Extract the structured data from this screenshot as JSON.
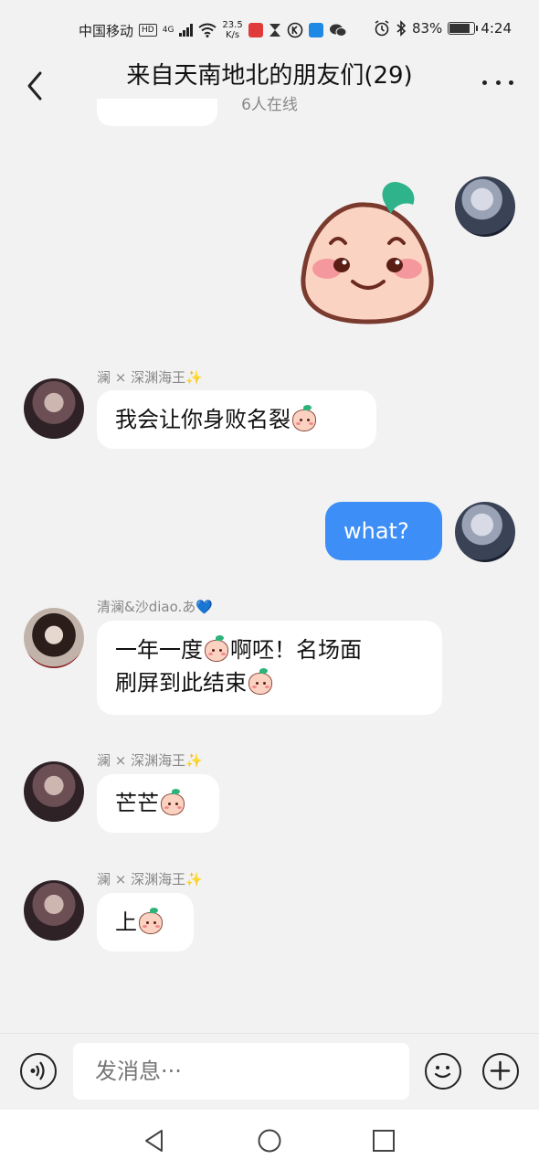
{
  "status_bar": {
    "carrier": "中国移动",
    "hd_badge": "HD",
    "network_type": "4G",
    "speed_value": "23.5",
    "speed_unit": "K/s",
    "battery_percent": "83%",
    "battery_level": 0.83,
    "time": "4:24"
  },
  "header": {
    "title": "来自天南地北的朋友们(29)",
    "online": "6人在线"
  },
  "messages": {
    "m1": {
      "sender": "澜 × 深渊海王✨",
      "text": "我会让你身败名裂"
    },
    "m2": {
      "text": "what?"
    },
    "m3": {
      "sender": "清澜&沙diao.あ💙",
      "line1": "一年一度",
      "line1b": "啊呸！名场面",
      "line2": "刷屏到此结束"
    },
    "m4": {
      "sender": "澜 × 深渊海王✨",
      "text": "芒芒"
    },
    "m5": {
      "sender": "澜 × 深渊海王✨",
      "text": "上"
    }
  },
  "input": {
    "placeholder": "发消息···"
  },
  "icons": {
    "voice": "voice-icon",
    "emoji": "emoji-icon",
    "plus": "plus-icon",
    "back": "back-arrow-icon",
    "more": "more-icon"
  },
  "colors": {
    "my_bubble": "#3d8ef6",
    "other_bubble": "#ffffff",
    "background": "#f2f2f2"
  }
}
